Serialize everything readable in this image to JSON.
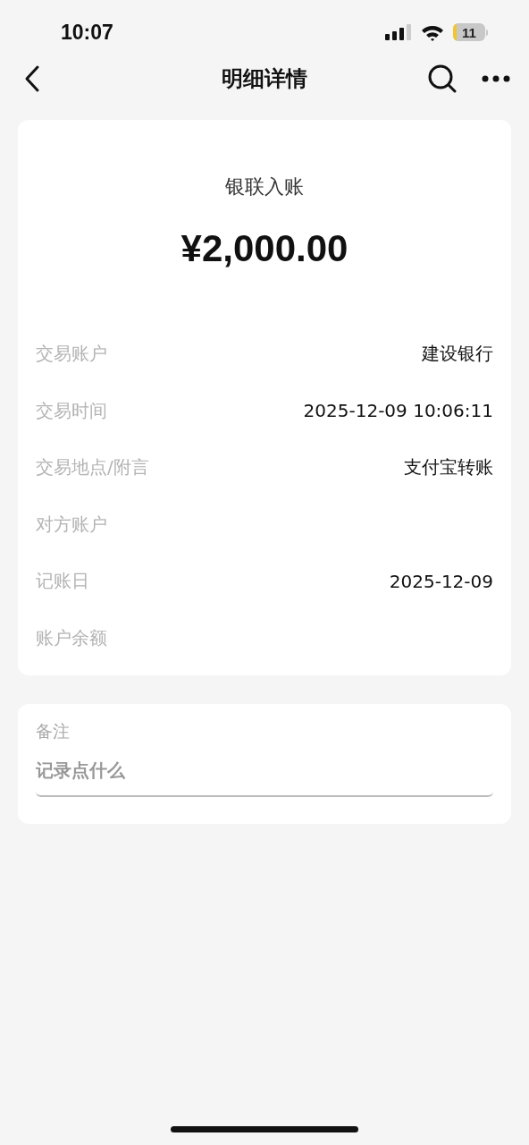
{
  "status_bar": {
    "time": "10:07",
    "battery": "11"
  },
  "nav": {
    "title": "明细详情"
  },
  "summary": {
    "title": "银联入账",
    "amount": "¥2,000.00"
  },
  "details": [
    {
      "label": "交易账户",
      "value": "建设银行"
    },
    {
      "label": "交易时间",
      "value": "2025-12-09 10:06:11"
    },
    {
      "label": "交易地点/附言",
      "value": "支付宝转账"
    },
    {
      "label": "对方账户"
    },
    {
      "label": "记账日",
      "value": "2025-12-09"
    },
    {
      "label": "账户余额"
    }
  ],
  "note": {
    "label": "备注",
    "placeholder": "记录点什么"
  }
}
